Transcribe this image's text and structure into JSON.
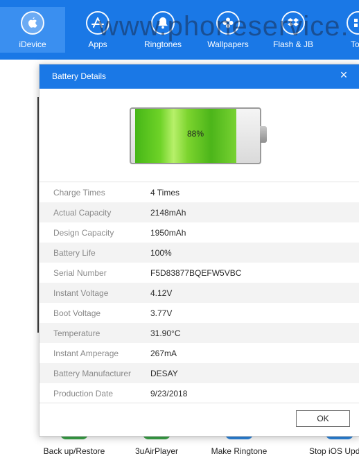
{
  "watermark": "www.phoneservice.",
  "toolbar": {
    "items": [
      {
        "label": "iDevice",
        "icon": "apple-icon",
        "active": true
      },
      {
        "label": "Apps",
        "icon": "app-store-icon"
      },
      {
        "label": "Ringtones",
        "icon": "bell-icon"
      },
      {
        "label": "Wallpapers",
        "icon": "flower-icon"
      },
      {
        "label": "Flash & JB",
        "icon": "dropbox-icon"
      },
      {
        "label": "Tool",
        "icon": "tool-icon"
      }
    ]
  },
  "bottom_tools": [
    {
      "label": "Back up/Restore",
      "color": "#3aa548"
    },
    {
      "label": "3uAirPlayer",
      "color": "#3aa548"
    },
    {
      "label": "Make Ringtone",
      "color": "#2d87e0"
    },
    {
      "label": "Stop iOS Upda",
      "color": "#2d87e0"
    }
  ],
  "dialog": {
    "title": "Battery Details",
    "close": "×",
    "battery_percent_text": "88%",
    "battery_level": 0.88,
    "ok_label": "OK",
    "rows": [
      {
        "label": "Charge Times",
        "value": "4 Times"
      },
      {
        "label": "Actual Capacity",
        "value": "2148mAh"
      },
      {
        "label": "Design Capacity",
        "value": "1950mAh"
      },
      {
        "label": "Battery Life",
        "value": "100%"
      },
      {
        "label": "Serial Number",
        "value": "F5D83877BQEFW5VBC"
      },
      {
        "label": "Instant Voltage",
        "value": "4.12V"
      },
      {
        "label": "Boot Voltage",
        "value": "3.77V"
      },
      {
        "label": "Temperature",
        "value": "31.90°C"
      },
      {
        "label": "Instant Amperage",
        "value": "267mA"
      },
      {
        "label": "Battery Manufacturer",
        "value": "DESAY"
      },
      {
        "label": "Production Date",
        "value": "9/23/2018"
      }
    ]
  }
}
